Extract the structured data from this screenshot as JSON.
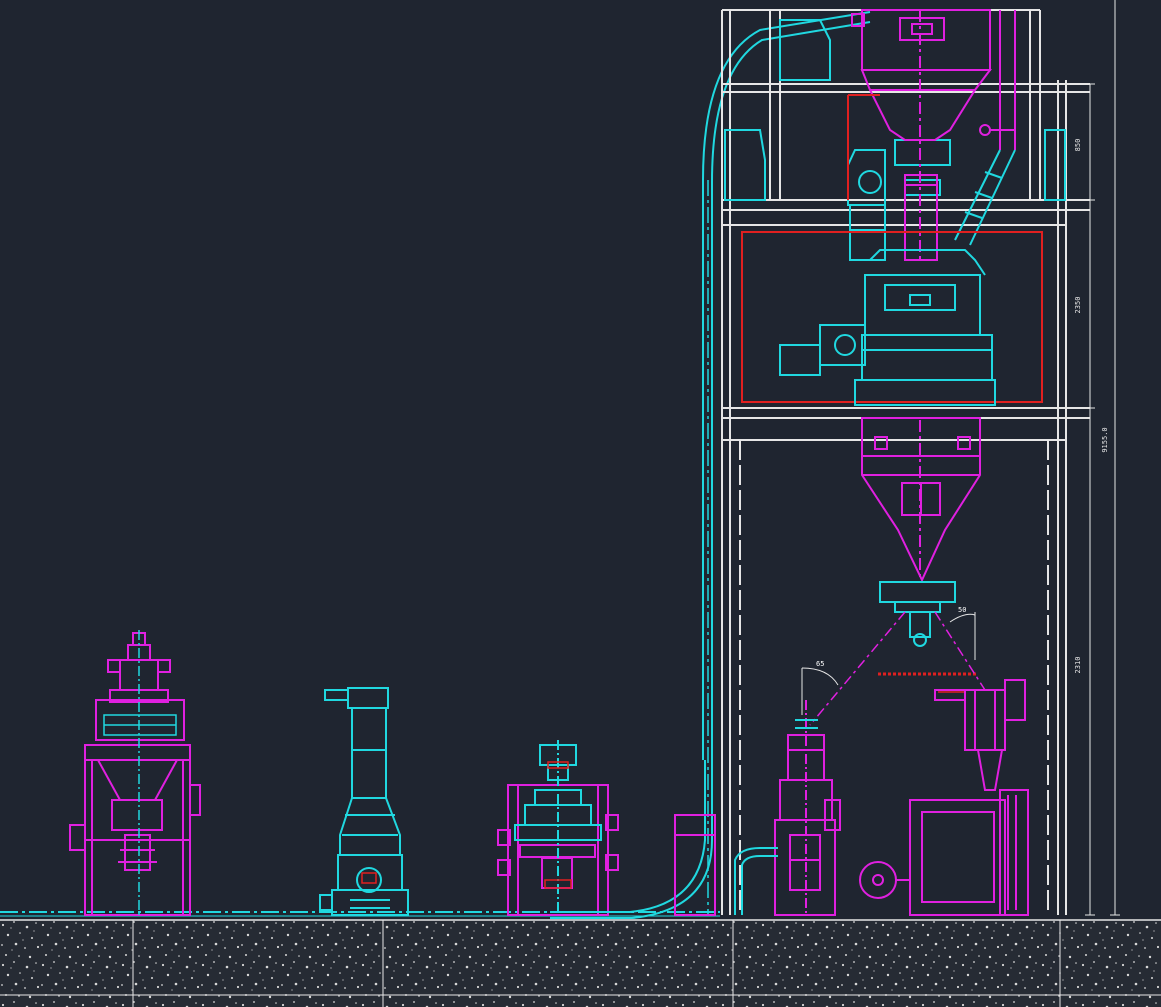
{
  "drawing": {
    "background_color": "#1f2530",
    "colors": {
      "magenta": "#e020e0",
      "cyan": "#20d8e0",
      "white": "#e6e6e6",
      "red": "#e02020",
      "ground_fill": "#2a2f38",
      "ground_speckle": "#d8d8d8"
    },
    "dimensions": {
      "d1": "850",
      "d2": "2350",
      "d3": "2310",
      "d4": "9155.0"
    },
    "angles": {
      "a1": "65",
      "a2": "50"
    }
  }
}
